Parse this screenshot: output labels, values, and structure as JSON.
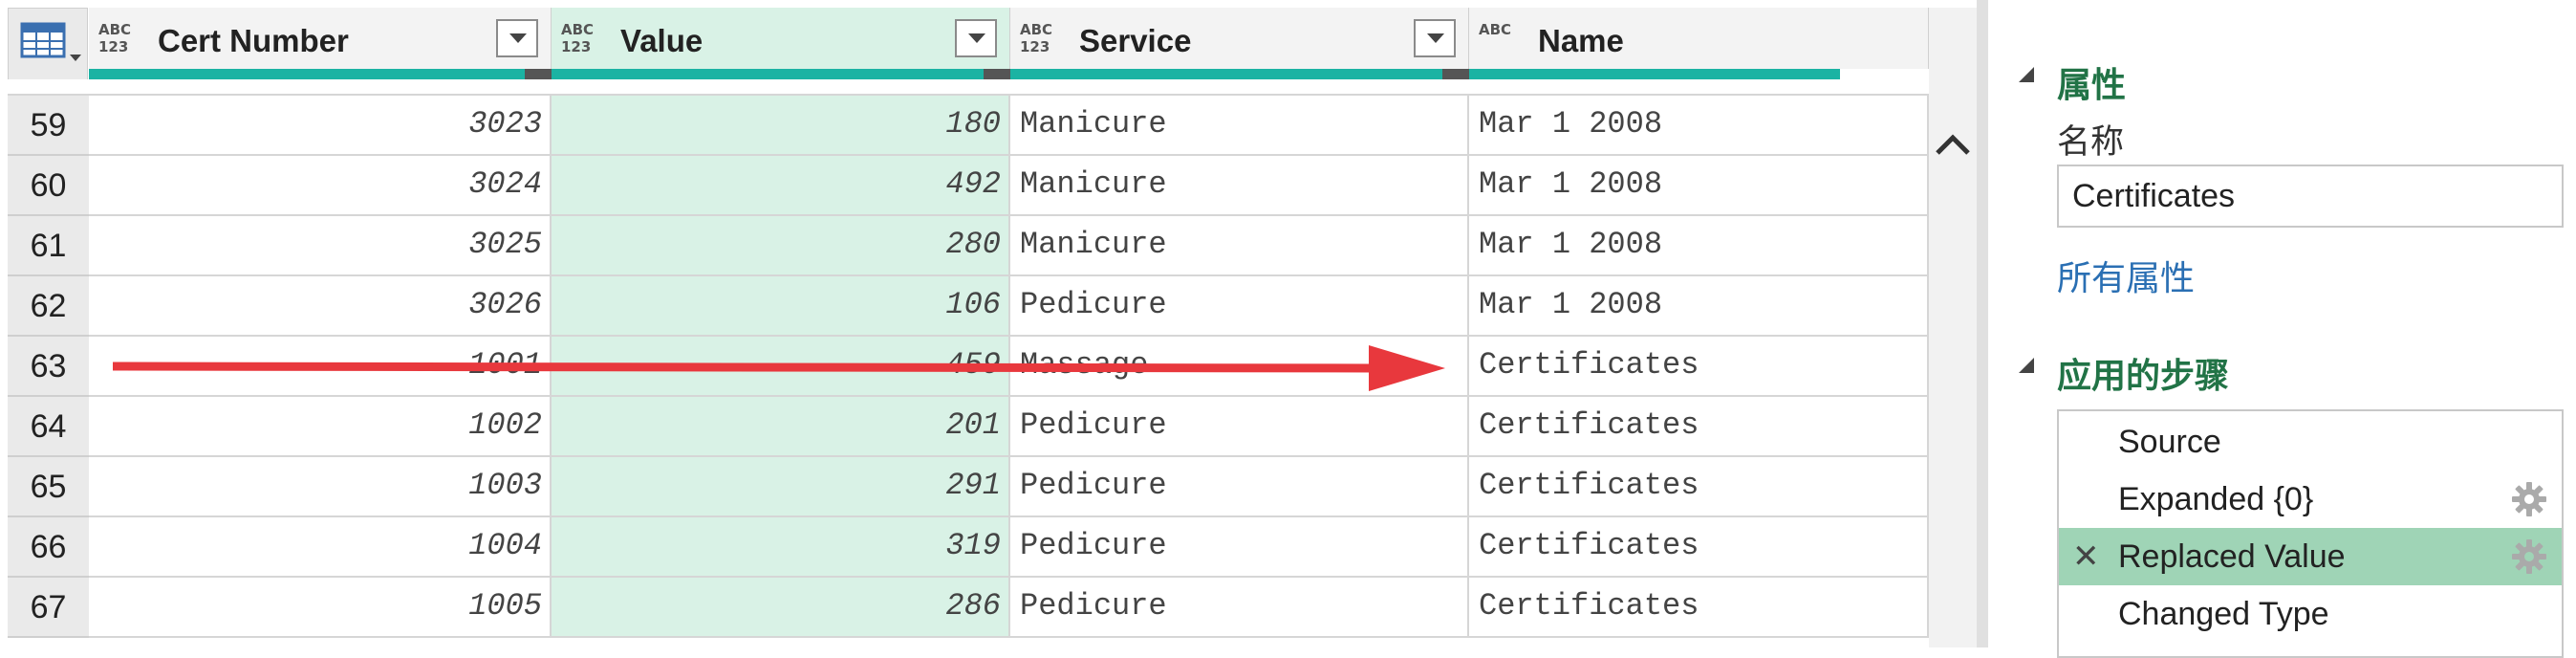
{
  "grid": {
    "columns": [
      {
        "type_top": "ABC",
        "type_bottom": "123",
        "title": "Cert Number",
        "selected": false,
        "dropdown": true
      },
      {
        "type_top": "ABC",
        "type_bottom": "123",
        "title": "Value",
        "selected": true,
        "dropdown": true
      },
      {
        "type_top": "ABC",
        "type_bottom": "123",
        "title": "Service",
        "selected": false,
        "dropdown": true
      },
      {
        "type_top": "ABC",
        "type_bottom": "",
        "title": "Name",
        "selected": false,
        "dropdown": false
      }
    ],
    "rows": [
      {
        "n": "59",
        "cert": "3023",
        "value": "180",
        "service": "Manicure",
        "name": "Mar 1 2008"
      },
      {
        "n": "60",
        "cert": "3024",
        "value": "492",
        "service": "Manicure",
        "name": "Mar 1 2008"
      },
      {
        "n": "61",
        "cert": "3025",
        "value": "280",
        "service": "Manicure",
        "name": "Mar 1 2008"
      },
      {
        "n": "62",
        "cert": "3026",
        "value": "106",
        "service": "Pedicure",
        "name": "Mar 1 2008"
      },
      {
        "n": "63",
        "cert": "1001",
        "value": "459",
        "service": "Massage",
        "name": "Certificates"
      },
      {
        "n": "64",
        "cert": "1002",
        "value": "201",
        "service": "Pedicure",
        "name": "Certificates"
      },
      {
        "n": "65",
        "cert": "1003",
        "value": "291",
        "service": "Pedicure",
        "name": "Certificates"
      },
      {
        "n": "66",
        "cert": "1004",
        "value": "319",
        "service": "Pedicure",
        "name": "Certificates"
      },
      {
        "n": "67",
        "cert": "1005",
        "value": "286",
        "service": "Pedicure",
        "name": "Certificates"
      }
    ],
    "annotation_arrow_color": "#e8383d",
    "quality_bar_color": "#1bb3a3",
    "selected_column_color": "#d9f2e6"
  },
  "properties": {
    "heading": "属性",
    "name_label": "名称",
    "name_value": "Certificates",
    "all_properties_link": "所有属性"
  },
  "applied_steps": {
    "heading": "应用的步骤",
    "steps": [
      {
        "label": "Source",
        "gear": false,
        "active": false
      },
      {
        "label": "Expanded {0}",
        "gear": true,
        "active": false
      },
      {
        "label": "Replaced Value",
        "gear": true,
        "active": true
      },
      {
        "label": "Changed Type",
        "gear": false,
        "active": false
      }
    ],
    "active_color": "#9fd4b6"
  }
}
